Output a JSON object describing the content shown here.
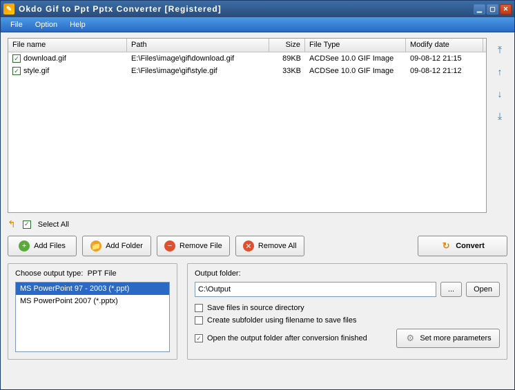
{
  "window": {
    "title": "Okdo Gif to Ppt Pptx Converter [Registered]"
  },
  "menu": {
    "file": "File",
    "option": "Option",
    "help": "Help"
  },
  "grid": {
    "headers": {
      "name": "File name",
      "path": "Path",
      "size": "Size",
      "type": "File Type",
      "date": "Modify date"
    },
    "rows": [
      {
        "checked": true,
        "name": "download.gif",
        "path": "E:\\Files\\image\\gif\\download.gif",
        "size": "89KB",
        "type": "ACDSee 10.0 GIF Image",
        "date": "09-08-12 21:15"
      },
      {
        "checked": true,
        "name": "style.gif",
        "path": "E:\\Files\\image\\gif\\style.gif",
        "size": "33KB",
        "type": "ACDSee 10.0 GIF Image",
        "date": "09-08-12 21:12"
      }
    ]
  },
  "selectAll": {
    "label": "Select All",
    "checked": true
  },
  "buttons": {
    "addFiles": "Add Files",
    "addFolder": "Add Folder",
    "removeFile": "Remove File",
    "removeAll": "Remove All",
    "convert": "Convert"
  },
  "outputType": {
    "label": "Choose output type:",
    "current": "PPT File",
    "options": [
      {
        "text": "MS PowerPoint 97 - 2003 (*.ppt)",
        "selected": true
      },
      {
        "text": "MS PowerPoint 2007 (*.pptx)",
        "selected": false
      }
    ]
  },
  "outputFolder": {
    "label": "Output folder:",
    "value": "C:\\Output",
    "browse": "...",
    "open": "Open"
  },
  "options": {
    "saveInSource": {
      "label": "Save files in source directory",
      "checked": false
    },
    "createSubfolder": {
      "label": "Create subfolder using filename to save files",
      "checked": false
    },
    "openAfter": {
      "label": "Open the output folder after conversion finished",
      "checked": true
    }
  },
  "moreParams": "Set more parameters"
}
